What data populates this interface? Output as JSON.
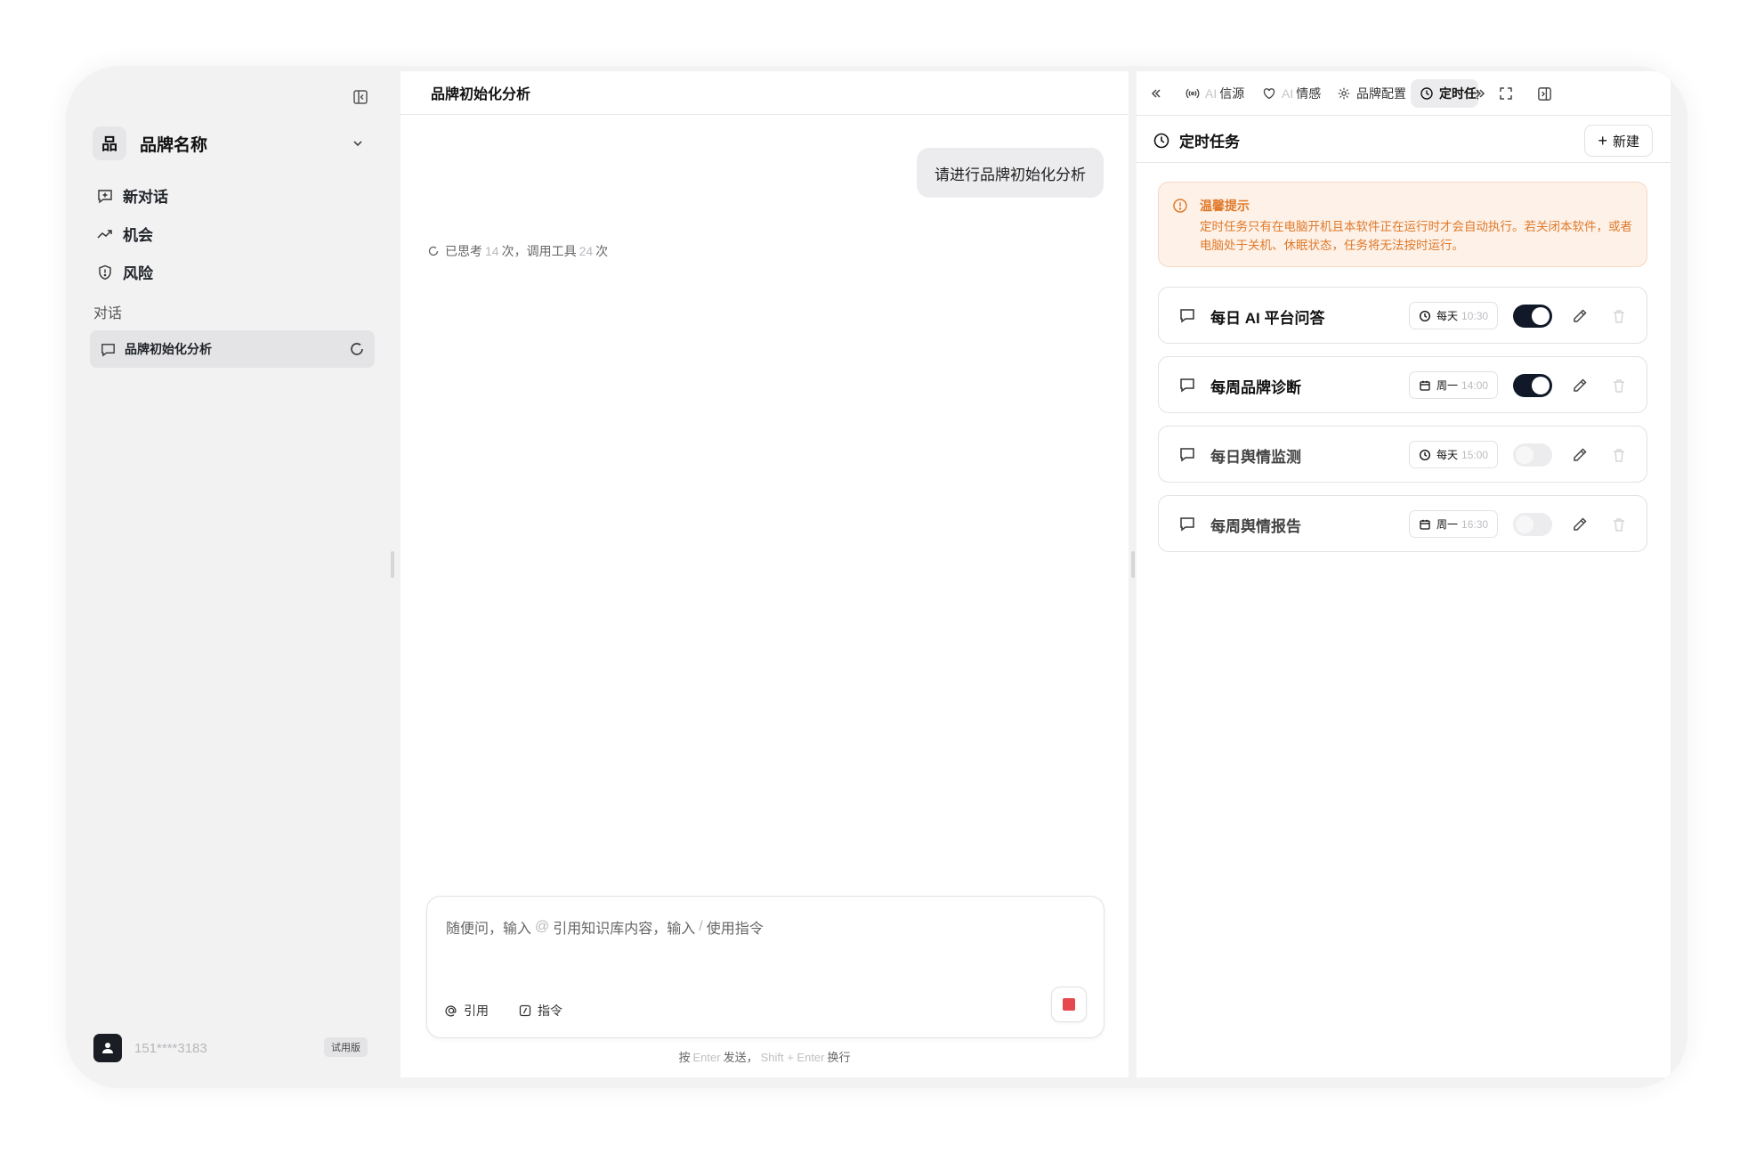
{
  "sidebar": {
    "brand_mark": "品",
    "brand_name": "品牌名称",
    "nav": [
      {
        "label": "新对话",
        "icon": "new-chat-icon"
      },
      {
        "label": "机会",
        "icon": "trend-up-icon"
      },
      {
        "label": "风险",
        "icon": "shield-icon"
      }
    ],
    "section_label": "对话",
    "conversations": [
      {
        "label": "品牌初始化分析",
        "status": "loading"
      }
    ],
    "user": {
      "phone": "151****3183",
      "plan_badge": "试用版"
    }
  },
  "main": {
    "title": "品牌初始化分析",
    "user_message": "请进行品牌初始化分析",
    "thinking": {
      "prefix": "已思考",
      "think_count": "14",
      "mid": "次，调用工具",
      "tool_count": "24",
      "suffix": "次"
    },
    "composer": {
      "placeholder_parts": [
        "随便问，输入",
        "@",
        "引用知识库内容，输入",
        "/",
        "使用指令"
      ],
      "tool_cite": "引用",
      "tool_command": "指令"
    },
    "hint": {
      "p1": "按",
      "k1": "Enter",
      "p2": "发送，",
      "k2": "Shift + Enter",
      "p3": "换行"
    }
  },
  "panel": {
    "tabs": [
      {
        "dim": "AI",
        "label": "信源",
        "icon": "signal-icon"
      },
      {
        "dim": "AI",
        "label": "情感",
        "icon": "heart-icon"
      },
      {
        "dim": "",
        "label": "品牌配置",
        "icon": "gear-icon"
      },
      {
        "dim": "",
        "label": "定时任务",
        "icon": "clock-icon",
        "active": true
      }
    ],
    "header_title": "定时任务",
    "new_button": "新建",
    "notice": {
      "title": "温馨提示",
      "body": "定时任务只有在电脑开机且本软件正在运行时才会自动执行。若关闭本软件，或者电脑处于关机、休眠状态，任务将无法按时运行。"
    },
    "tasks": [
      {
        "name": "每日 AI 平台问答",
        "freq": "每天",
        "time": "10:30",
        "schedule_icon": "clock-icon",
        "enabled": true
      },
      {
        "name": "每周品牌诊断",
        "freq": "周一",
        "time": "14:00",
        "schedule_icon": "calendar-icon",
        "enabled": true
      },
      {
        "name": "每日舆情监测",
        "freq": "每天",
        "time": "15:00",
        "schedule_icon": "clock-icon",
        "enabled": false
      },
      {
        "name": "每周舆情报告",
        "freq": "周一",
        "time": "16:30",
        "schedule_icon": "calendar-icon",
        "enabled": false
      }
    ]
  },
  "colors": {
    "accent_dark": "#111827",
    "warning": "#e07a2b",
    "warning_bg": "#fdf1e8",
    "stop": "#e5484d"
  }
}
